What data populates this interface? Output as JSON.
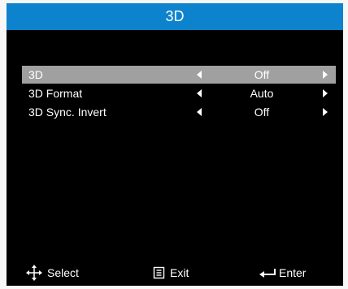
{
  "menu": {
    "title": "3D",
    "items": [
      {
        "label": "3D",
        "value": "Off",
        "selected": true
      },
      {
        "label": "3D Format",
        "value": "Auto",
        "selected": false
      },
      {
        "label": "3D Sync. Invert",
        "value": "Off",
        "selected": false
      }
    ]
  },
  "footer": {
    "select_label": "Select",
    "exit_label": "Exit",
    "enter_label": "Enter"
  },
  "colors": {
    "title_bar": "#0c83cc",
    "panel_background": "#000000",
    "selected_row": "#a0a0a0"
  },
  "icons": {
    "select": "four-way-arrow-icon",
    "exit": "menu-button-icon",
    "enter": "enter-return-icon",
    "decrease": "left-triangle-icon",
    "increase": "right-triangle-icon"
  }
}
